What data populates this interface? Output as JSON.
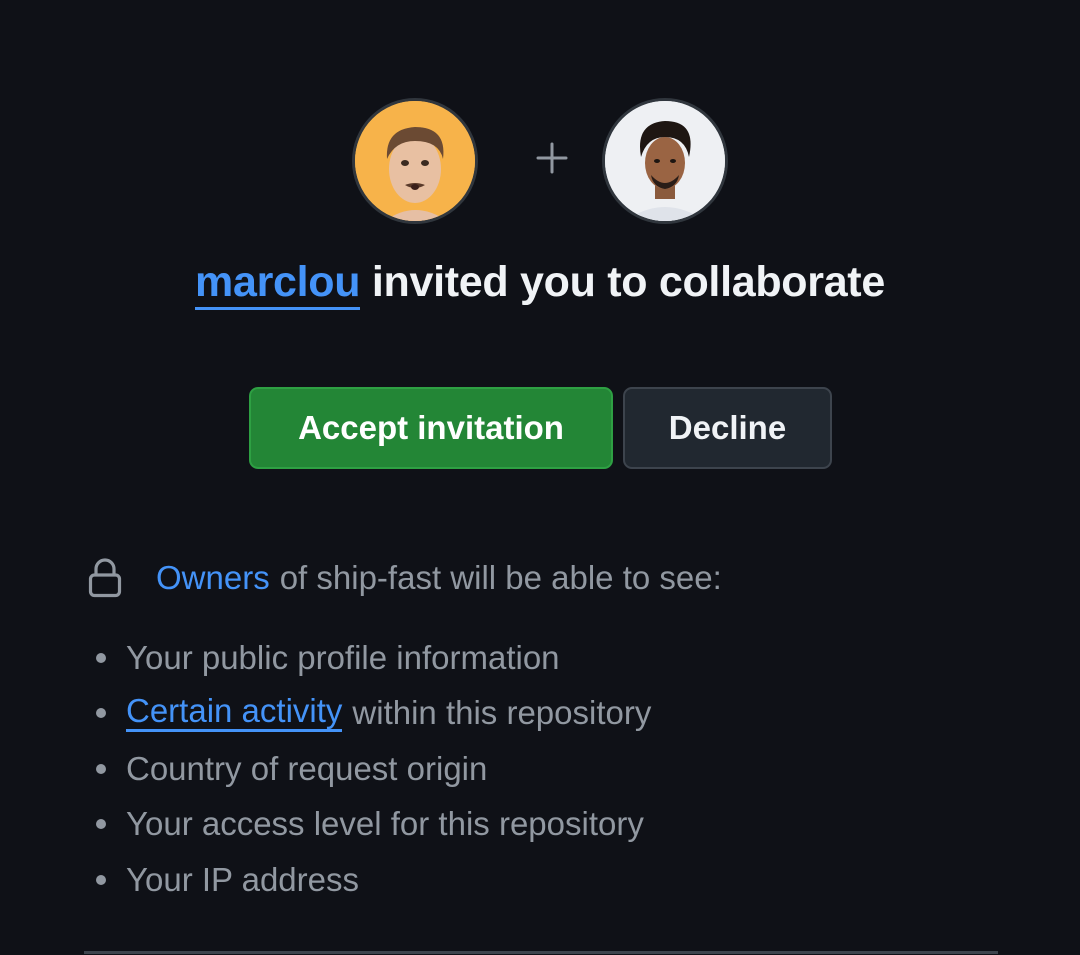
{
  "invite": {
    "inviter_name": "marclou",
    "headline_rest": "invited you to collaborate",
    "plus_symbol": "+"
  },
  "actions": {
    "accept_label": "Accept invitation",
    "decline_label": "Decline"
  },
  "visibility": {
    "owners_link": "Owners",
    "notice_rest": "of ship-fast will be able to see:",
    "items": [
      {
        "text": "Your public profile information"
      },
      {
        "link": "Certain activity",
        "text": "within this repository"
      },
      {
        "text": "Country of request origin"
      },
      {
        "text": "Your access level for this repository"
      },
      {
        "text": "Your IP address"
      }
    ]
  },
  "colors": {
    "background": "#0f1117",
    "link": "#4493f8",
    "accept_button": "#238636",
    "decline_button": "#212830",
    "muted_text": "#9198a1",
    "inviter_avatar_bg": "#f7b34a"
  }
}
